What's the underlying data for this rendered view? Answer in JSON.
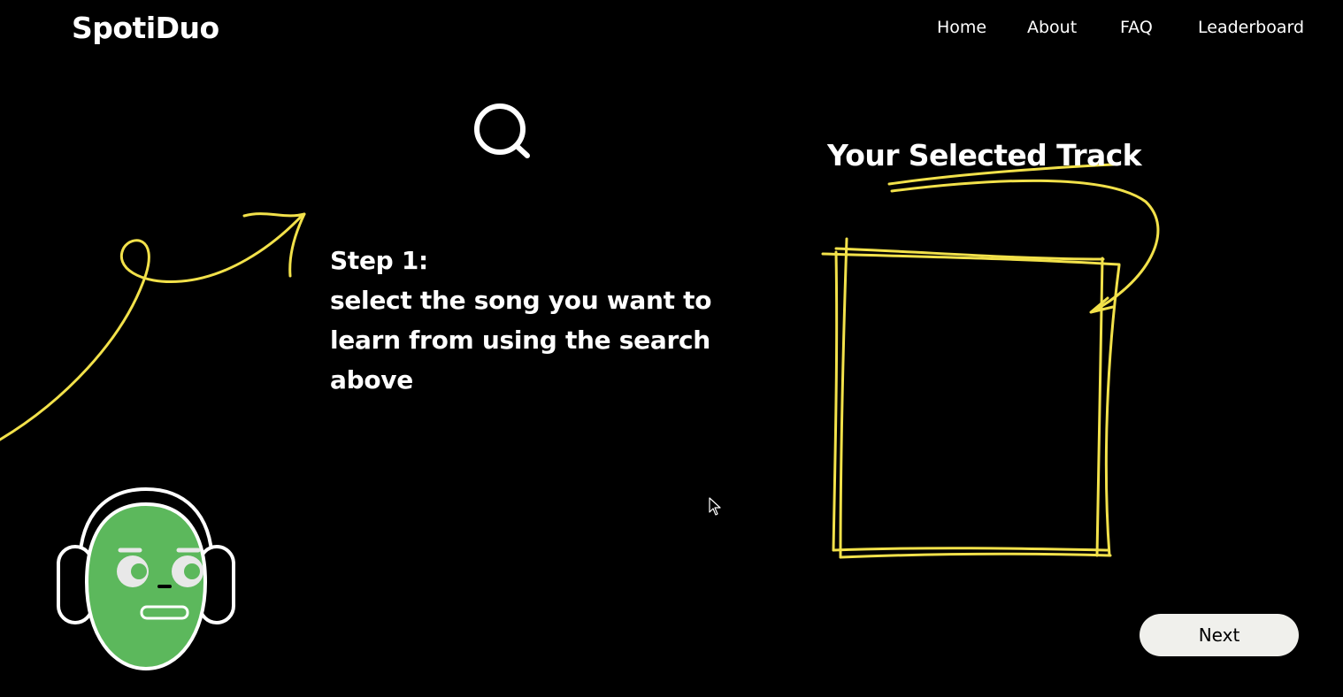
{
  "header": {
    "logo": "SpotiDuo",
    "nav": [
      {
        "label": "Home"
      },
      {
        "label": "About"
      },
      {
        "label": "FAQ"
      },
      {
        "label": "Leaderboard"
      }
    ]
  },
  "search": {
    "icon": "search-icon"
  },
  "instructions": {
    "step_label": "Step 1:",
    "lines": [
      "select the song you want to",
      "learn from using the search",
      "above"
    ]
  },
  "track_panel": {
    "title": "Your Selected Track"
  },
  "actions": {
    "next_label": "Next"
  },
  "colors": {
    "background": "#000000",
    "text": "#ffffff",
    "doodle_yellow": "#f2e14a",
    "mascot_green": "#5cb85c",
    "button_bg": "#f0f0ec"
  }
}
